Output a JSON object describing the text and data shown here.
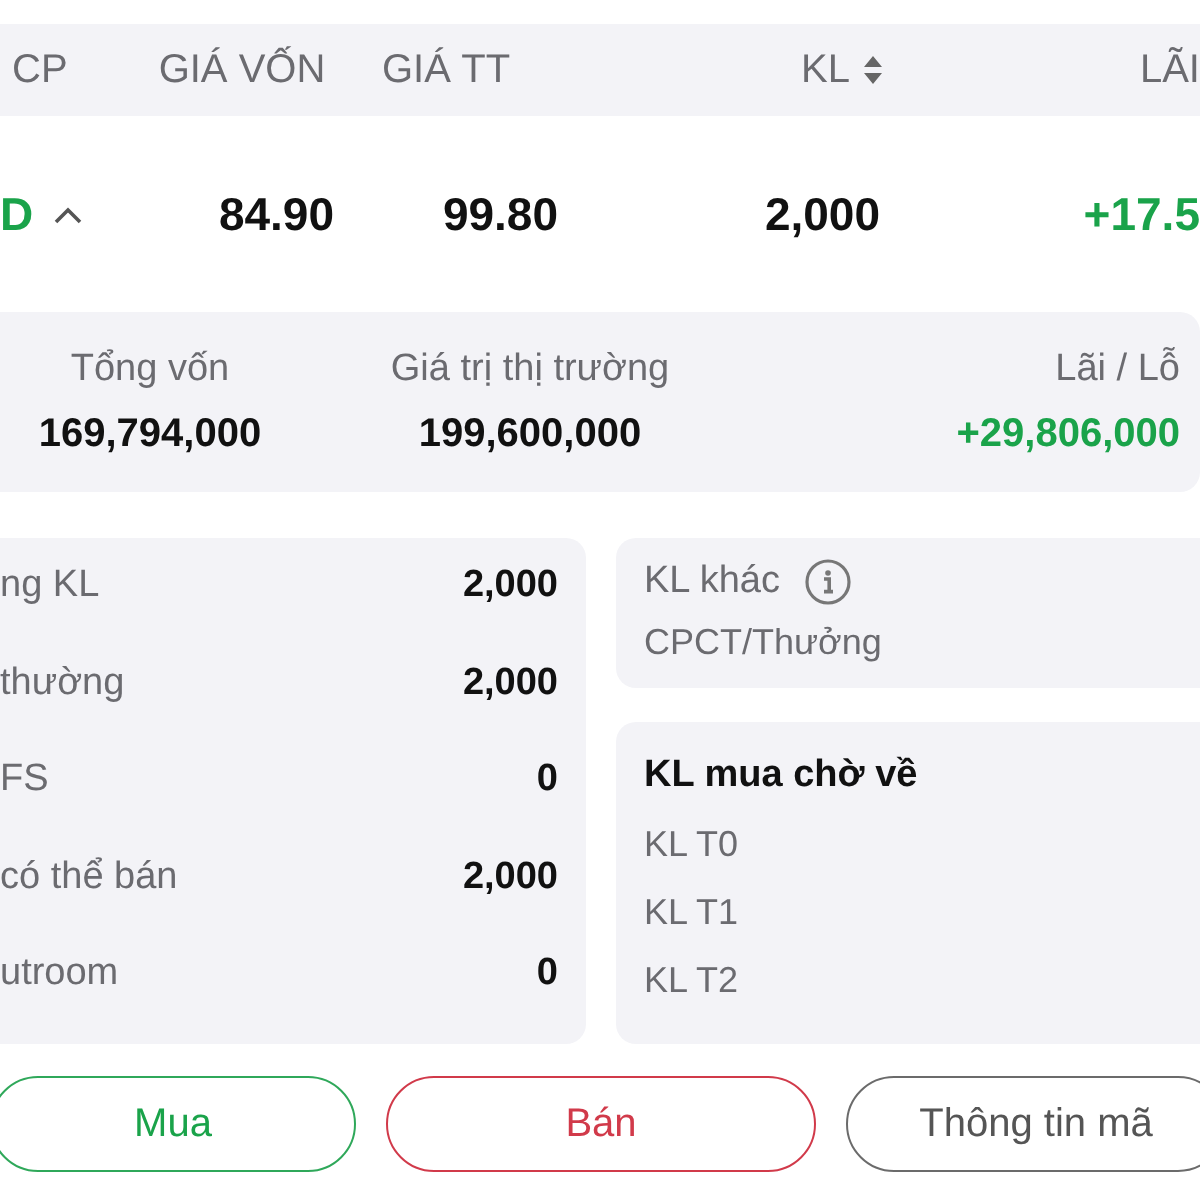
{
  "table": {
    "columns": [
      {
        "label": "CP",
        "sortable": false
      },
      {
        "label": "GIÁ VỐN",
        "sortable": false
      },
      {
        "label": "GIÁ TT",
        "sortable": false
      },
      {
        "label": "KL",
        "sortable": true
      },
      {
        "label": "LÃI",
        "sortable": false
      }
    ],
    "row": {
      "symbol": "D",
      "expanded": true,
      "cost_price": "84.90",
      "market_price": "99.80",
      "volume": "2,000",
      "profit": "+17.5"
    }
  },
  "summary": [
    {
      "label": "Tổng vốn",
      "value": "169,794,000",
      "positive": false
    },
    {
      "label": "Giá trị thị trường",
      "value": "199,600,000",
      "positive": false
    },
    {
      "label": "Lãi / Lỗ",
      "value": "+29,806,000",
      "positive": true
    }
  ],
  "volume_details": [
    {
      "label": "ng KL",
      "value": "2,000"
    },
    {
      "label": "thường",
      "value": "2,000"
    },
    {
      "label": "FS",
      "value": "0"
    },
    {
      "label": "có thể bán",
      "value": "2,000"
    },
    {
      "label": "utroom",
      "value": "0"
    }
  ],
  "other_volume": {
    "title": "KL khác",
    "items": [
      "CPCT/Thưởng"
    ]
  },
  "pending_buy": {
    "title": "KL mua chờ về",
    "items": [
      "KL T0",
      "KL T1",
      "KL T2"
    ]
  },
  "buttons": [
    {
      "label": "Mua",
      "kind": "buy"
    },
    {
      "label": "Bán",
      "kind": "sell"
    },
    {
      "label": "Thông tin mã",
      "kind": "info"
    }
  ]
}
